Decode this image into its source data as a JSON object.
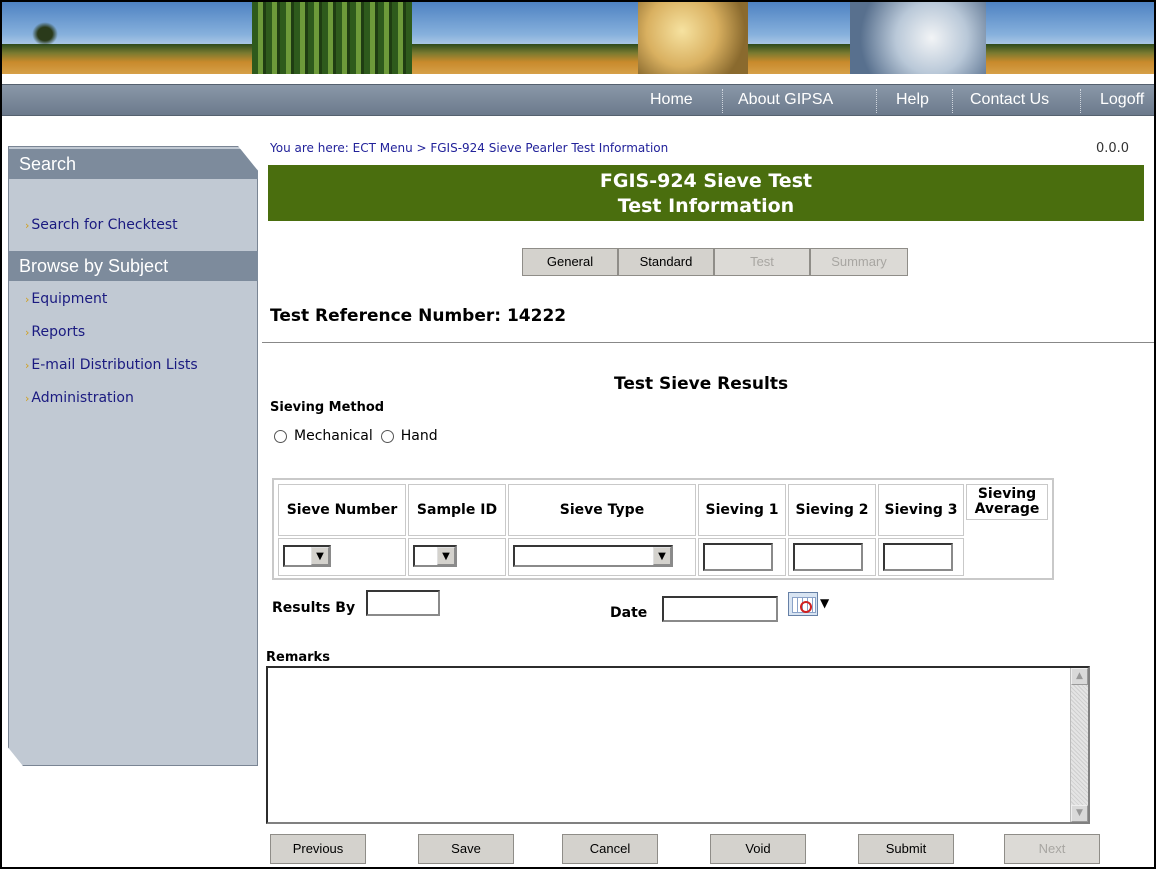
{
  "nav": {
    "home": "Home",
    "about": "About GIPSA",
    "help": "Help",
    "contact": "Contact Us",
    "logoff": "Logoff"
  },
  "sidebar": {
    "search_heading": "Search",
    "search_link": "Search for Checktest",
    "browse_heading": "Browse by Subject",
    "links": [
      "Equipment",
      "Reports",
      "E-mail Distribution Lists",
      "Administration"
    ]
  },
  "breadcrumb": "You are here: ECT Menu > FGIS-924 Sieve Pearler Test Information",
  "version": "0.0.0",
  "title": {
    "line1": "FGIS-924 Sieve Test",
    "line2": "Test Information"
  },
  "tabs": [
    "General",
    "Standard",
    "Test",
    "Summary"
  ],
  "reference": "Test Reference Number: 14222",
  "section_title": "Test Sieve Results",
  "sieving_method": {
    "label": "Sieving Method",
    "options": [
      "Mechanical",
      "Hand"
    ]
  },
  "table": {
    "headers": [
      "Sieve Number",
      "Sample ID",
      "Sieve Type",
      "Sieving 1",
      "Sieving 2",
      "Sieving 3",
      "Sieving Average"
    ]
  },
  "results_by_label": "Results By",
  "date_label": "Date",
  "remarks_label": "Remarks",
  "buttons": {
    "previous": "Previous",
    "save": "Save",
    "cancel": "Cancel",
    "void": "Void",
    "submit": "Submit",
    "next": "Next"
  }
}
